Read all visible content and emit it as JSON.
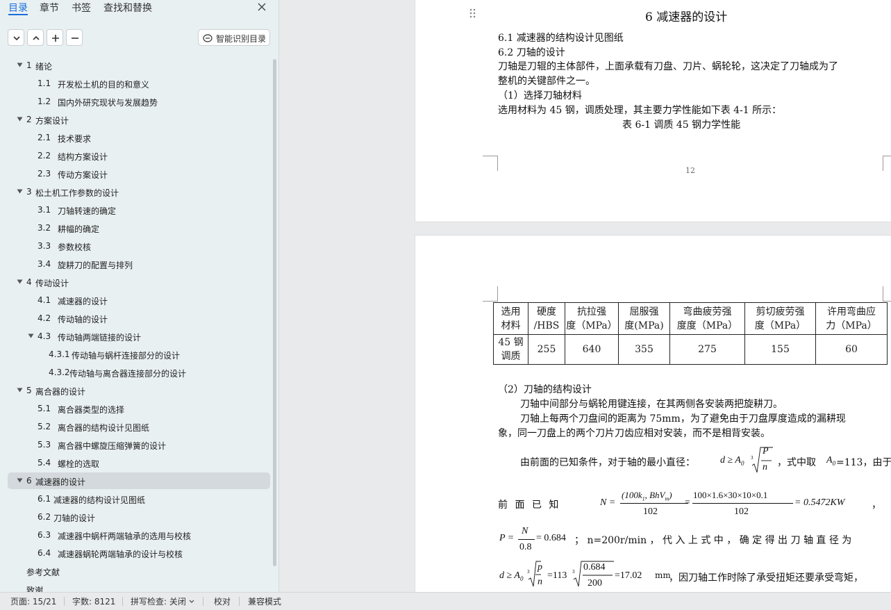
{
  "nav": {
    "tabs": [
      "目录",
      "章节",
      "书签",
      "查找和替换"
    ],
    "ai_button": "智能识别目录",
    "outline": [
      {
        "level": 1,
        "num": "1",
        "text": "绪论",
        "expanded": true
      },
      {
        "level": 2,
        "num": "1.1",
        "text": "开发松土机的目的和意义"
      },
      {
        "level": 2,
        "num": "1.2",
        "text": "国内外研究现状与发展趋势"
      },
      {
        "level": 1,
        "num": "2",
        "text": "方案设计",
        "expanded": true
      },
      {
        "level": 2,
        "num": "2.1",
        "text": "技术要求"
      },
      {
        "level": 2,
        "num": "2.2",
        "text": "结构方案设计"
      },
      {
        "level": 2,
        "num": "2.3",
        "text": "传动方案设计"
      },
      {
        "level": 1,
        "num": "3",
        "text": "松土机工作参数的设计",
        "expanded": true
      },
      {
        "level": 2,
        "num": "3.1",
        "text": "刀轴转速的确定"
      },
      {
        "level": 2,
        "num": "3.2",
        "text": "耕幅的确定"
      },
      {
        "level": 2,
        "num": "3.3",
        "text": "参数校核"
      },
      {
        "level": 2,
        "num": "3.4",
        "text": "旋耕刀的配置与排列"
      },
      {
        "level": 1,
        "num": "4",
        "text": "传动设计",
        "expanded": true
      },
      {
        "level": 2,
        "num": "4.1",
        "text": "减速器的设计"
      },
      {
        "level": 2,
        "num": "4.2",
        "text": "传动轴的设计"
      },
      {
        "level": 2,
        "num": "4.3",
        "text": "传动轴两端链接的设计",
        "expanded": true
      },
      {
        "level": 3,
        "num": "4.3.1",
        "text": "传动轴与蜗杆连接部分的设计"
      },
      {
        "level": 3,
        "num": "4.3.2",
        "text": "传动轴与离合器连接部分的设计"
      },
      {
        "level": 1,
        "num": "5",
        "text": "离合器的设计",
        "expanded": true
      },
      {
        "level": 2,
        "num": "5.1",
        "text": "离合器类型的选择"
      },
      {
        "level": 2,
        "num": "5.2",
        "text": "离合器的结构设计见图纸"
      },
      {
        "level": 2,
        "num": "5.3",
        "text": "离合器中螺旋压缩弹簧的设计"
      },
      {
        "level": 2,
        "num": "5.4",
        "text": "螺栓的选取"
      },
      {
        "level": 1,
        "num": "6",
        "text": "减速器的设计",
        "expanded": true,
        "selected": true
      },
      {
        "level": 2,
        "num": "6.1",
        "text": "减速器的结构设计见图纸"
      },
      {
        "level": 2,
        "num": "6.2",
        "text": "刀轴的设计"
      },
      {
        "level": 2,
        "num": "6.3",
        "text": "减速器中蜗杆两端轴承的选用与校核"
      },
      {
        "level": 2,
        "num": "6.4",
        "text": "减速器蜗轮两端轴承的设计与校核"
      },
      {
        "level": 1,
        "num": "",
        "text": "参考文献"
      },
      {
        "level": 1,
        "num": "",
        "text": "致谢"
      }
    ]
  },
  "doc": {
    "heading": "6 减速器的设计",
    "p1_lines": [
      "6.1 减速器的结构设计见图纸",
      "6.2 刀轴的设计",
      "刀轴是刀辊的主体部件，上面承载有刀盘、刀片、蜗轮轮，这决定了刀轴成为了",
      "整机的关键部件之一。",
      "（1）选择刀轴材料",
      "选用材料为 45 钢，调质处理，其主要力学性能如下表 4-1 所示："
    ],
    "table_caption": "表 6-1  调质 45 钢力学性能",
    "page_number": "12",
    "table": {
      "headers": [
        [
          "选用",
          "材料"
        ],
        [
          "硬度",
          "/HBS"
        ],
        [
          "抗拉强",
          "度（MPa）"
        ],
        [
          "屈服强",
          "度(MPa)"
        ],
        [
          "弯曲疲劳强",
          "度度（MPa）"
        ],
        [
          "剪切疲劳强",
          "度（MPa）"
        ],
        [
          "许用弯曲应",
          "力（MPa）"
        ]
      ],
      "row": [
        [
          "45 钢",
          "调质"
        ],
        [
          "255"
        ],
        [
          "640"
        ],
        [
          "355"
        ],
        [
          "275"
        ],
        [
          "155"
        ],
        [
          "60"
        ]
      ]
    },
    "p2": {
      "sub": "（2）刀轴的结构设计",
      "l1": "刀轴中间部分与蜗轮用键连接，在其两侧各安装两把旋耕刀。",
      "l2": "刀轴上每两个刀盘间的距离为 75mm，为了避免由于刀盘厚度造成的漏耕现",
      "l3": "象，同一刀盘上的两个刀片刀齿应相对安装，而不是相背安装。",
      "l4a": "由前面的已知条件，对于轴的最小直径：",
      "l4b": "，式中取",
      "l4c": "=113，由于",
      "l5a": "前  面  已  知",
      "l5end": "，",
      "l6b": "；  n=200r/min ， 代 入 上 式 中 ， 确 定 得 出 刀 轴 直 径 为",
      "l7b": "，因刀轴工作时除了承受扭矩还要承受弯矩，",
      "f_d": "d ≥ A",
      "f_A0": "A",
      "f_N_lhs": "N =",
      "f_N_num": "(100k",
      "f_N_num2": "BhV",
      "f_N_den": "102",
      "f_N_num_b": "100×1.6×30×10×0.1",
      "f_N_den_b": "102",
      "f_N_res": "= 0.5472KW",
      "f_P_lhs": "P =",
      "f_P_num": "N",
      "f_P_den": "0.8",
      "f_P_res": "= 0.684",
      "f_d2_lhs": "d ≥ A",
      "f_d2_p": "p",
      "f_d2_n": "n",
      "f_d2_mid": "=113",
      "f_d2_num": "0.684",
      "f_d2_den": "200",
      "f_d2_res": "=17.02",
      "f_d2_unit": "mm"
    }
  },
  "status": {
    "page": "页面: 15/21",
    "words": "字数: 8121",
    "spell": "拼写检查: 关闭",
    "proof": "校对",
    "compat": "兼容模式"
  }
}
